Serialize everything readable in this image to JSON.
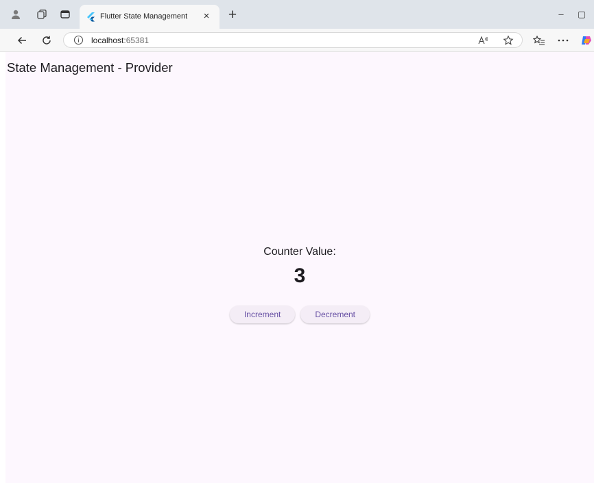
{
  "browser": {
    "tab_title": "Flutter State Management",
    "tab_close_glyph": "×",
    "new_tab_glyph": "+",
    "url_host": "localhost",
    "url_port": ":65381",
    "window_controls": {
      "minimize": "–",
      "maximize": "▢",
      "close": "✕"
    },
    "icons": [
      "profile-icon",
      "workspaces-icon",
      "tab-actions-icon",
      "flutter-favicon",
      "back-icon",
      "refresh-icon",
      "site-info-icon",
      "read-aloud-icon",
      "favorite-star-icon",
      "favorites-list-icon",
      "more-icon",
      "copilot-icon"
    ],
    "colors": {
      "tabstrip": "#dfe4ea",
      "toolbar": "#f7f7f7"
    }
  },
  "app": {
    "title": "State Management - Provider",
    "counter_label": "Counter Value:",
    "counter_value": "3",
    "increment_label": "Increment",
    "decrement_label": "Decrement",
    "colors": {
      "background": "#fdf7fe",
      "button_bg": "#f4edf6",
      "button_text": "#6750a4"
    }
  }
}
